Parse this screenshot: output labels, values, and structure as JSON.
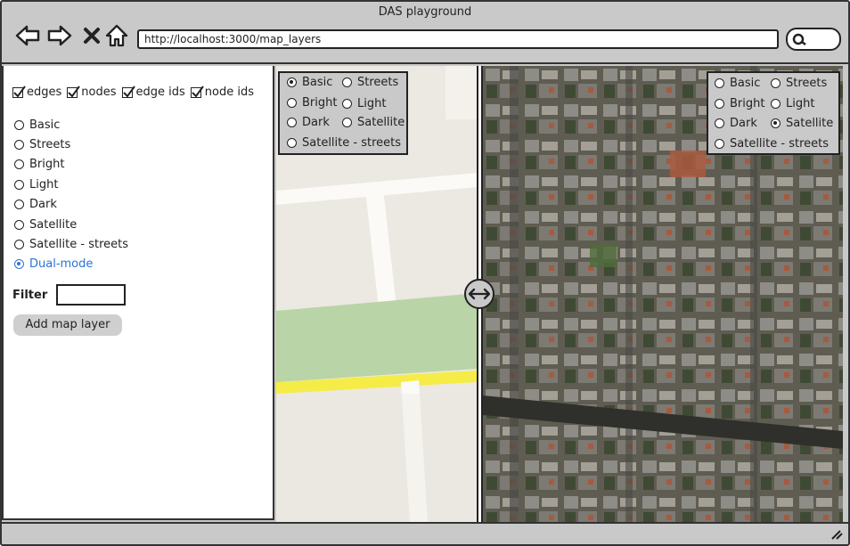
{
  "window": {
    "title": "DAS playground"
  },
  "toolbar": {
    "back_icon": "back-arrow-icon",
    "forward_icon": "forward-arrow-icon",
    "stop_icon": "close-icon",
    "home_icon": "home-icon",
    "url": "http://localhost:3000/map_layers",
    "search_icon": "search-icon"
  },
  "sidebar": {
    "checkboxes": [
      {
        "label": "edges",
        "checked": true
      },
      {
        "label": "nodes",
        "checked": true
      },
      {
        "label": "edge ids",
        "checked": true
      },
      {
        "label": "node ids",
        "checked": true
      }
    ],
    "layers": [
      {
        "label": "Basic",
        "selected": false
      },
      {
        "label": "Streets",
        "selected": false
      },
      {
        "label": "Bright",
        "selected": false
      },
      {
        "label": "Light",
        "selected": false
      },
      {
        "label": "Dark",
        "selected": false
      },
      {
        "label": "Satellite",
        "selected": false
      },
      {
        "label": "Satellite - streets",
        "selected": false
      },
      {
        "label": "Dual-mode",
        "selected": true
      }
    ],
    "filter_label": "Filter",
    "filter_value": "",
    "add_button": "Add map layer"
  },
  "left_map": {
    "options": [
      "Basic",
      "Streets",
      "Bright",
      "Light",
      "Dark",
      "Satellite",
      "Satellite - streets"
    ],
    "selected": "Basic"
  },
  "right_map": {
    "options": [
      "Basic",
      "Streets",
      "Bright",
      "Light",
      "Dark",
      "Satellite",
      "Satellite - streets"
    ],
    "selected": "Satellite"
  },
  "colors": {
    "accent": "#2a74d6",
    "park": "#b9d4a6",
    "road": "#f6ec47",
    "chrome": "#c9c9c9"
  }
}
